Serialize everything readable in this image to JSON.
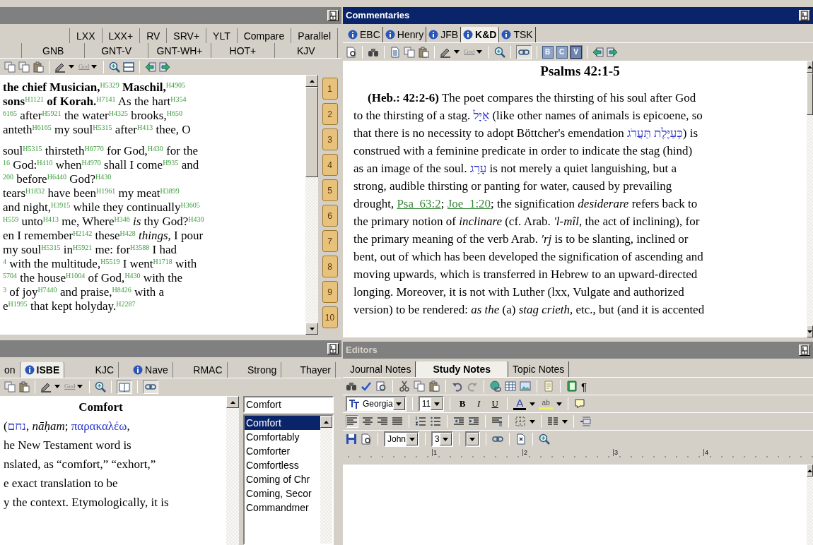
{
  "bible_pane": {
    "tabs_row_1": [
      "LXX",
      "LXX+",
      "RV",
      "SRV+",
      "YLT",
      "Compare",
      "Parallel"
    ],
    "tabs_row_2": [
      "GNB",
      "GNT-V",
      "GNT-WH+",
      "HOT+",
      "KJV"
    ],
    "toolbar": {
      "style_label": "God"
    },
    "stanzas": [
      [
        "**the chief Musician,**$^{H5329}$ **Maschil,**$^{H4905}$",
        "**sons**$^{H1121}$ **of Korah.**$^{H7141}$ As the hart$^{H354}$",
        "$^{6165}$ after$^{H5921}$ the water$^{H4325}$ brooks,$^{H650}$",
        "anteth$^{H6165}$ my soul$^{H5315}$ after$^{H413}$ thee, O"
      ],
      [
        "soul$^{H5315}$ thirsteth$^{H6770}$ for God,$^{H430}$ for the",
        "$^{16}$ God:$^{H410}$ when$^{H4970}$ shall I come$^{H935}$ and",
        "$^{200}$ before$^{H6440}$ God?$^{H430}$",
        "tears$^{H1832}$ have been$^{H1961}$ my meat$^{H3899}$",
        "and night,$^{H3915}$ while they continually$^{H3605}$",
        "$^{H559}$ unto$^{H413}$ me, Where$^{H346}$ *is* thy God?$^{H430}$",
        "en I remember$^{H2142}$ these$^{H428}$ *things,* I pour",
        "my soul$^{H5315}$ in$^{H5921}$ me: for$^{H3588}$ I had",
        "$^{4}$ with the multitude,$^{H5519}$ I went$^{H1718}$ with",
        "$^{5704}$ the house$^{H1004}$ of God,$^{H430}$ with the",
        "$^{3}$ of joy$^{H7440}$ and praise,$^{H8426}$ with a",
        "e$^{H1995}$ that kept holyday.$^{H2287}$"
      ]
    ],
    "verse_markers": [
      "1",
      "2",
      "3",
      "4",
      "5",
      "6",
      "7",
      "8",
      "9",
      "10"
    ]
  },
  "commentaries": {
    "title": "Commentaries",
    "tabs": [
      {
        "label": "EBC",
        "selected": false
      },
      {
        "label": "Henry",
        "selected": false
      },
      {
        "label": "JFB",
        "selected": false
      },
      {
        "label": "K&D",
        "selected": true
      },
      {
        "label": "TSK",
        "selected": false
      }
    ],
    "toolbar": {
      "style_label": "God",
      "link_on": true,
      "view_buttons": [
        {
          "label": "B",
          "on": false
        },
        {
          "label": "C",
          "on": false
        },
        {
          "label": "V",
          "on": true
        }
      ]
    },
    "heading": "Psalms 42:1-5",
    "lines": [
      [
        {
          "kind": "text",
          "text": "**(Heb.: 42:2-6)** The poet compares the thirsting of his soul after God"
        }
      ],
      [
        {
          "kind": "text",
          "text": "to the thirsting of a stag. "
        },
        {
          "kind": "hebrew",
          "text": "אַיָּל"
        },
        {
          "kind": "text",
          "text": " (like other names of animals is epicoene, so"
        }
      ],
      [
        {
          "kind": "text",
          "text": "that there is no necessity to adopt Böttcher's emendation "
        },
        {
          "kind": "hebrew",
          "text": "כְּעַיֶּלֶת תַּעֲרֹג"
        },
        {
          "kind": "text",
          "text": ") is"
        }
      ],
      [
        {
          "kind": "text",
          "text": "construed with a feminine predicate in order to indicate the stag (hind)"
        }
      ],
      [
        {
          "kind": "text",
          "text": "as an image of the soul. "
        },
        {
          "kind": "hebrew",
          "text": "עָרַג"
        },
        {
          "kind": "text",
          "text": " is not merely a quiet languishing, but a"
        }
      ],
      [
        {
          "kind": "text",
          "text": "strong, audible thirsting or panting for water, caused by prevailing"
        }
      ],
      [
        {
          "kind": "text",
          "text": "drought, "
        },
        {
          "kind": "link",
          "text": "Psa  63:2"
        },
        {
          "kind": "text",
          "text": "; "
        },
        {
          "kind": "link",
          "text": "Joe  1:20"
        },
        {
          "kind": "text",
          "text": "; the signification *desiderare* refers back to"
        }
      ],
      [
        {
          "kind": "text",
          "text": "the primary notion of *inclinare* (cf. Arab. *'l-mîl*, the act of inclining), for"
        }
      ],
      [
        {
          "kind": "text",
          "text": "the primary meaning of the verb Arab. *'rj* is to be slanting, inclined or"
        }
      ],
      [
        {
          "kind": "text",
          "text": "bent, out of which has been developed the signification of ascending and"
        }
      ],
      [
        {
          "kind": "text",
          "text": "moving upwards, which is transferred in Hebrew to an upward-directed"
        }
      ],
      [
        {
          "kind": "text",
          "text": "longing. Moreover, it is not with Luther (lxx, Vulgate and authorized"
        }
      ],
      [
        {
          "kind": "text",
          "text": "version) to be rendered: *as the* (a) *stag crieth*, etc., but (and it is accented"
        }
      ]
    ]
  },
  "dictionary_pane": {
    "tabs": [
      {
        "label": "on",
        "info": false,
        "selected": false
      },
      {
        "label": "ISBE",
        "info": true,
        "selected": true
      },
      {
        "label": "KJC",
        "info": false,
        "selected": false
      },
      {
        "label": "Nave",
        "info": true,
        "selected": false
      },
      {
        "label": "RMAC",
        "info": false,
        "selected": false
      },
      {
        "label": "Strong",
        "info": false,
        "selected": false
      },
      {
        "label": "Thayer",
        "info": false,
        "selected": false
      }
    ],
    "toolbar": {
      "style_label": "God",
      "book_on": true,
      "link_on": true
    },
    "heading": "Comfort",
    "lines": [
      [
        {
          "kind": "text",
          "text": "("
        },
        {
          "kind": "hebrew",
          "text": "נחם"
        },
        {
          "kind": "text",
          "text": ", *nāḥam*; "
        },
        {
          "kind": "greek",
          "text": "παρακαλέω"
        },
        {
          "kind": "text",
          "text": ","
        }
      ],
      [
        {
          "kind": "text",
          "text": "he New Testament word is"
        }
      ],
      [
        {
          "kind": "text",
          "text": "nslated, as “comfort,” “exhort,”"
        }
      ],
      [
        {
          "kind": "text",
          "text": "e exact translation to be"
        }
      ],
      [
        {
          "kind": "text",
          "text": "y the context. Etymologically, it is"
        }
      ]
    ],
    "search": {
      "value": "Comfort"
    },
    "topics": [
      {
        "label": "Comfort",
        "selected": true
      },
      {
        "label": "Comfortably",
        "selected": false
      },
      {
        "label": "Comforter",
        "selected": false
      },
      {
        "label": "Comfortless",
        "selected": false
      },
      {
        "label": "Coming of Chr",
        "selected": false
      },
      {
        "label": "Coming, Secor",
        "selected": false
      },
      {
        "label": "Commandmer",
        "selected": false
      }
    ]
  },
  "editors": {
    "title": "Editors",
    "tabs": [
      {
        "label": "Journal Notes",
        "selected": false
      },
      {
        "label": "Study Notes",
        "selected": true
      },
      {
        "label": "Topic Notes",
        "selected": false
      }
    ],
    "pilcrow": "¶",
    "font": "Georgia",
    "size": "11",
    "format_buttons": [
      "B",
      "I",
      "U"
    ],
    "font_color_label": "A",
    "highlight_label": "ab",
    "book": "John",
    "chapter": "3",
    "ruler_marks": [
      "1",
      "2",
      "3",
      "4"
    ]
  }
}
